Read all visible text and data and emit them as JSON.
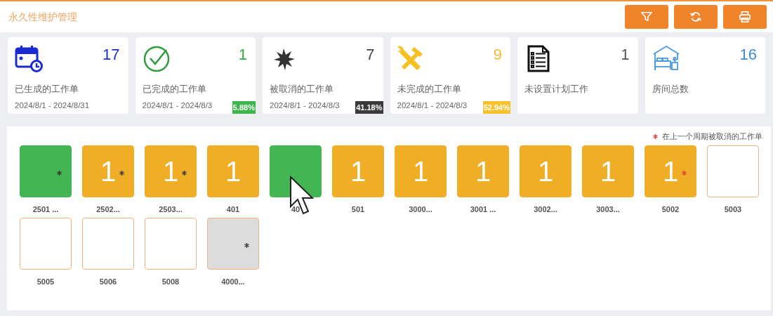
{
  "header": {
    "title": "永久性维护管理",
    "buttons": [
      {
        "kind": "filter"
      },
      {
        "kind": "refresh"
      },
      {
        "kind": "print"
      }
    ]
  },
  "stats": [
    {
      "count": "17",
      "title": "已生成的工作单",
      "date_range": "2024/8/1 - 2024/8/31"
    },
    {
      "count": "1",
      "title": "已完成的工作单",
      "date_range": "2024/8/1 - 2024/8/3",
      "percent": "5.88%"
    },
    {
      "count": "7",
      "title": "被取消的工作单",
      "date_range": "2024/8/1 - 2024/8/3",
      "percent": "41.18%"
    },
    {
      "count": "9",
      "title": "未完成的工作单",
      "date_range": "2024/8/1 - 2024/8/3",
      "percent": "52.94%"
    },
    {
      "count": "1",
      "title": "未设置计划工作"
    },
    {
      "count": "16",
      "title": "房间总数"
    }
  ],
  "legend": {
    "text": "在上一个周期被取消的工作单"
  },
  "rooms": [
    {
      "label": "2501 ...",
      "kind": "completed",
      "color": "#333333"
    },
    {
      "label": "2502...",
      "kind": "pending",
      "count": "1",
      "color": "#333333"
    },
    {
      "label": "2503...",
      "kind": "pending",
      "count": "1",
      "color": "#333333"
    },
    {
      "label": "401",
      "kind": "pending",
      "count": "1"
    },
    {
      "label": "40",
      "kind": "completed"
    },
    {
      "label": "501",
      "kind": "pending",
      "count": "1"
    },
    {
      "label": "3000...",
      "kind": "pending",
      "count": "1"
    },
    {
      "label": "3001 ...",
      "kind": "pending",
      "count": "1"
    },
    {
      "label": "3002...",
      "kind": "pending",
      "count": "1"
    },
    {
      "label": "3003...",
      "kind": "pending",
      "count": "1"
    },
    {
      "label": "5002",
      "kind": "pending",
      "count": "1",
      "color": "#e53935"
    },
    {
      "label": "5003",
      "kind": "empty"
    },
    {
      "label": "5005",
      "kind": "empty"
    },
    {
      "label": "5006",
      "kind": "empty"
    },
    {
      "label": "5008",
      "kind": "empty"
    },
    {
      "label": "4000...",
      "kind": "cancelled",
      "color": "#333333"
    }
  ]
}
